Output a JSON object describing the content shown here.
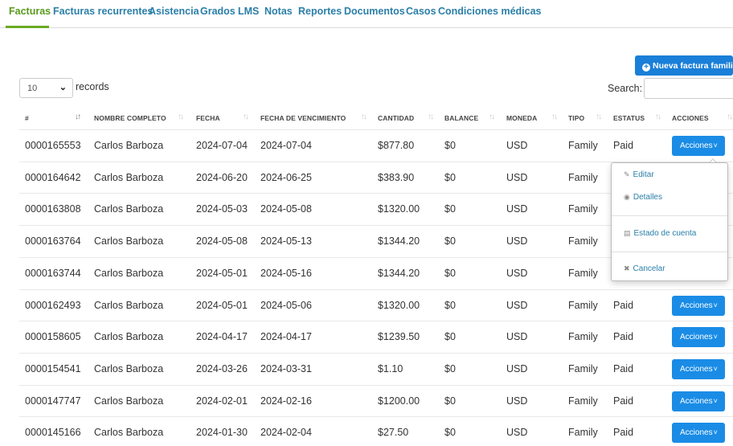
{
  "tabs": [
    {
      "label": "Facturas",
      "active": true
    },
    {
      "label": "Facturas recurrentes"
    },
    {
      "label": "Asistencia"
    },
    {
      "label": "Grados"
    },
    {
      "label": "LMS"
    },
    {
      "label": "Notas"
    },
    {
      "label": "Reportes"
    },
    {
      "label": "Documentos"
    },
    {
      "label": "Casos"
    },
    {
      "label": "Condiciones médicas"
    }
  ],
  "toolbar": {
    "new_button_label": "Nueva factura familiar",
    "page_length": "10",
    "records_label": "records",
    "search_label": "Search:",
    "search_value": ""
  },
  "table": {
    "columns": [
      "#",
      "NOMBRE COMPLETO",
      "FECHA",
      "FECHA DE VENCIMIENTO",
      "CANTIDAD",
      "BALANCE",
      "MONEDA",
      "TIPO",
      "ESTATUS",
      "ACCIONES"
    ],
    "rows": [
      {
        "id": "0000165553",
        "name": "Carlos Barboza",
        "date": "2024-07-04",
        "due": "2024-07-04",
        "amount": "$877.80",
        "balance": "$0",
        "currency": "USD",
        "type": "Family",
        "status": "Paid",
        "action": "Acciones"
      },
      {
        "id": "0000164642",
        "name": "Carlos Barboza",
        "date": "2024-06-20",
        "due": "2024-06-25",
        "amount": "$383.90",
        "balance": "$0",
        "currency": "USD",
        "type": "Family",
        "status": "",
        "action": ""
      },
      {
        "id": "0000163808",
        "name": "Carlos Barboza",
        "date": "2024-05-03",
        "due": "2024-05-08",
        "amount": "$1320.00",
        "balance": "$0",
        "currency": "USD",
        "type": "Family",
        "status": "",
        "action": ""
      },
      {
        "id": "0000163764",
        "name": "Carlos Barboza",
        "date": "2024-05-08",
        "due": "2024-05-13",
        "amount": "$1344.20",
        "balance": "$0",
        "currency": "USD",
        "type": "Family",
        "status": "",
        "action": ""
      },
      {
        "id": "0000163744",
        "name": "Carlos Barboza",
        "date": "2024-05-01",
        "due": "2024-05-16",
        "amount": "$1344.20",
        "balance": "$0",
        "currency": "USD",
        "type": "Family",
        "status": "",
        "action": ""
      },
      {
        "id": "0000162493",
        "name": "Carlos Barboza",
        "date": "2024-05-01",
        "due": "2024-05-06",
        "amount": "$1320.00",
        "balance": "$0",
        "currency": "USD",
        "type": "Family",
        "status": "Paid",
        "action": "Acciones"
      },
      {
        "id": "0000158605",
        "name": "Carlos Barboza",
        "date": "2024-04-17",
        "due": "2024-04-17",
        "amount": "$1239.50",
        "balance": "$0",
        "currency": "USD",
        "type": "Family",
        "status": "Paid",
        "action": "Acciones"
      },
      {
        "id": "0000154541",
        "name": "Carlos Barboza",
        "date": "2024-03-26",
        "due": "2024-03-31",
        "amount": "$1.10",
        "balance": "$0",
        "currency": "USD",
        "type": "Family",
        "status": "Paid",
        "action": "Acciones"
      },
      {
        "id": "0000147747",
        "name": "Carlos Barboza",
        "date": "2024-02-01",
        "due": "2024-02-16",
        "amount": "$1200.00",
        "balance": "$0",
        "currency": "USD",
        "type": "Family",
        "status": "Paid",
        "action": "Acciones"
      },
      {
        "id": "0000145166",
        "name": "Carlos Barboza",
        "date": "2024-01-30",
        "due": "2024-02-04",
        "amount": "$27.50",
        "balance": "$0",
        "currency": "USD",
        "type": "Family",
        "status": "Paid",
        "action": "Acciones"
      }
    ]
  },
  "dropdown": {
    "items": [
      {
        "label": "Editar",
        "icon": "edit-icon"
      },
      {
        "label": "Detalles",
        "icon": "eye-icon"
      },
      {
        "label": "Estado de cuenta",
        "icon": "document-icon"
      },
      {
        "label": "Cancelar",
        "icon": "close-icon"
      }
    ]
  },
  "colors": {
    "accent_green": "#6aaa22",
    "link_blue": "#2a7fa8",
    "button_blue": "#1a8ce6"
  }
}
